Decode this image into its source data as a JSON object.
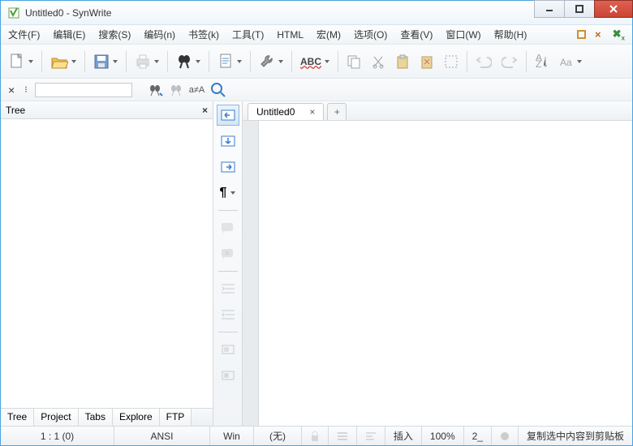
{
  "title": "Untitled0 - SynWrite",
  "menu": [
    "文件(F)",
    "编辑(E)",
    "搜索(S)",
    "编码(n)",
    "书签(k)",
    "工具(T)",
    "HTML",
    "宏(M)",
    "选项(O)",
    "查看(V)",
    "窗口(W)",
    "帮助(H)"
  ],
  "toolbar": {
    "spell": "ABC"
  },
  "search": {
    "placeholder": ""
  },
  "panel": {
    "title": "Tree",
    "tabs": [
      "Tree",
      "Project",
      "Tabs",
      "Explore",
      "FTP"
    ]
  },
  "tabs": {
    "main": "Untitled0",
    "plus": "+"
  },
  "status": {
    "pos": "1 : 1 (0)",
    "enc": "ANSI",
    "eol": "Win",
    "lexer": "(无)",
    "insert": "插入",
    "zoom": "100%",
    "tab": "2_",
    "msg": "复制选中内容到剪贴板"
  }
}
